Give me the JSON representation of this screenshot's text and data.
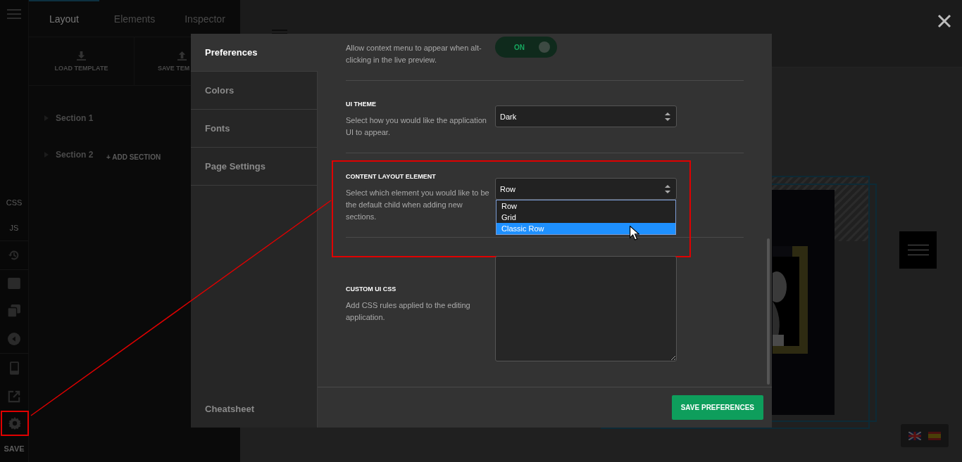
{
  "rail": {
    "texts": [
      "CSS",
      "JS"
    ],
    "save": "SAVE",
    "settings_highlighted": true
  },
  "panel": {
    "tabs": [
      {
        "label": "Layout",
        "selected": true
      },
      {
        "label": "Elements",
        "selected": false
      },
      {
        "label": "Inspector",
        "selected": false
      }
    ],
    "template_buttons": [
      {
        "label": "LOAD TEMPLATE",
        "kind": "download"
      },
      {
        "label": "SAVE TEM",
        "kind": "upload"
      }
    ],
    "sections": [
      {
        "label": "Section 1"
      },
      {
        "label": "Section 2"
      }
    ],
    "add_section": "+ ADD SECTION"
  },
  "modal": {
    "nav": [
      {
        "label": "Preferences",
        "selected": true
      },
      {
        "label": "Colors",
        "selected": false
      },
      {
        "label": "Fonts",
        "selected": false
      },
      {
        "label": "Page Settings",
        "selected": false
      }
    ],
    "cheatsheet": "Cheatsheet",
    "settings": [
      {
        "kind": "toggle",
        "description": "Allow context menu to appear when alt-clicking in the live preview.",
        "value": "ON",
        "on": true
      },
      {
        "kind": "select",
        "title": "UI THEME",
        "description": "Select how you would like the application UI to appear.",
        "value": "Dark",
        "open": false
      },
      {
        "kind": "select",
        "title": "CONTENT LAYOUT ELEMENT",
        "description": "Select which element you would like to be the default child when adding new sections.",
        "value": "Row",
        "open": true,
        "highlighted": true,
        "options": [
          {
            "label": "Row",
            "hovered": false
          },
          {
            "label": "Grid",
            "hovered": false
          },
          {
            "label": "Classic Row",
            "hovered": true
          }
        ]
      },
      {
        "kind": "textarea",
        "title": "CUSTOM UI CSS",
        "description": "Add CSS rules applied to the editing application."
      }
    ],
    "save_button": "SAVE PREFERENCES"
  }
}
